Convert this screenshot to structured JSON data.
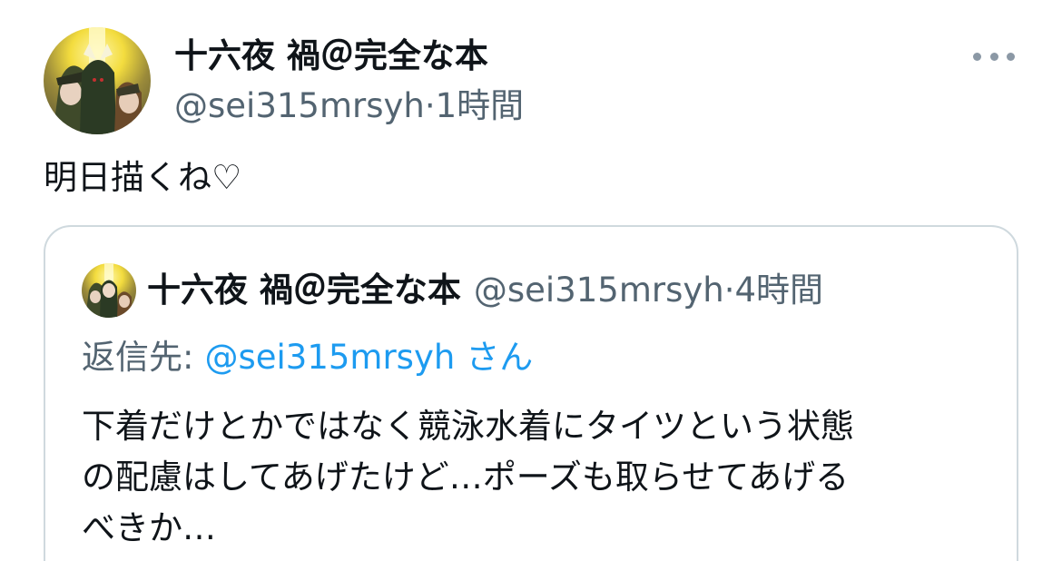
{
  "tweet": {
    "author": {
      "display_name": "十六夜 禍＠完全な本",
      "handle": "@sei315mrsyh",
      "time": "1時間",
      "avatar_icon": "anime-group-avatar"
    },
    "meta_separator": "·",
    "text": "明日描くね♡",
    "more_icon": "ellipsis-icon"
  },
  "quote": {
    "author": {
      "display_name": "十六夜 禍＠完全な本",
      "handle": "@sei315mrsyh",
      "time": "4時間"
    },
    "meta_separator": "·",
    "reply_prefix": "返信先:",
    "reply_mention": "@sei315mrsyh",
    "reply_suffix": "さん",
    "body_lines": [
      "下着だけとかではなく競泳水着にタイツという状態",
      "の配慮はしてあげたけど…ポーズも取らせてあげる",
      "べきか…"
    ]
  },
  "colors": {
    "text_primary": "#0f1419",
    "text_secondary": "#536471",
    "link": "#1d9bf0",
    "border": "#cfd9de"
  }
}
